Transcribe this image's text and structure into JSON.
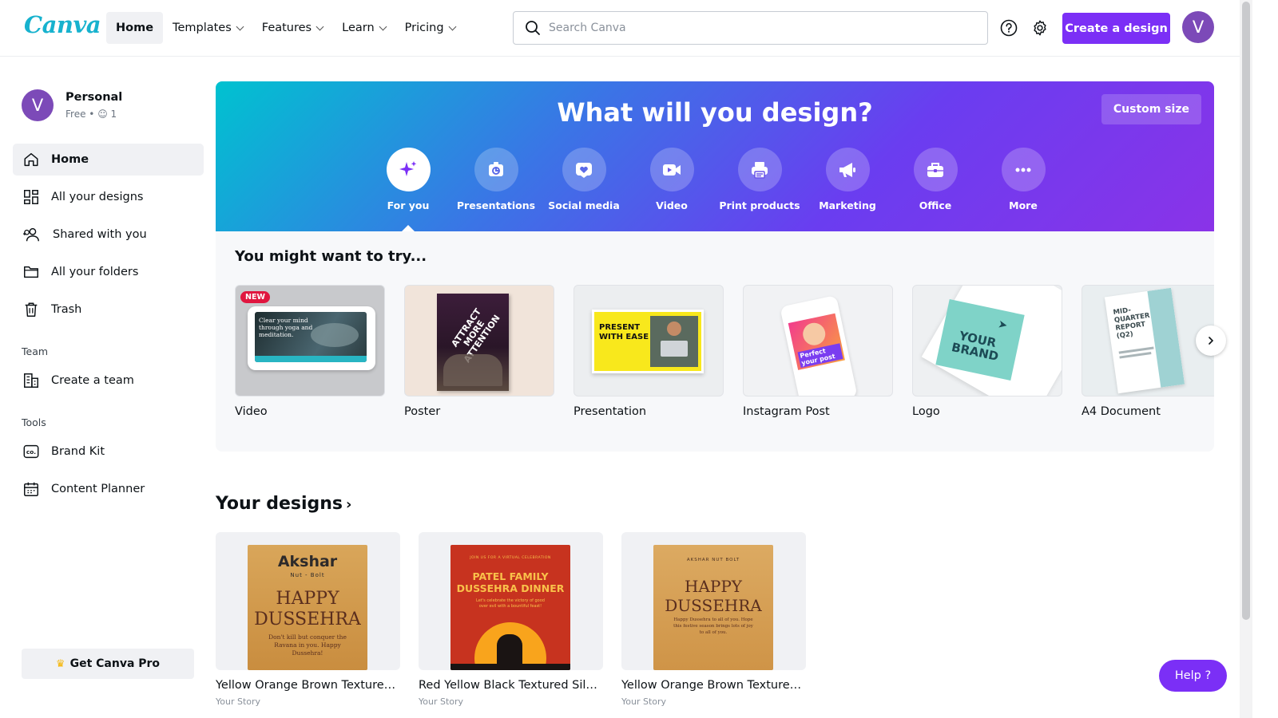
{
  "app": {
    "logo": "Canva"
  },
  "nav": {
    "home": "Home",
    "templates": "Templates",
    "features": "Features",
    "learn": "Learn",
    "pricing": "Pricing"
  },
  "search": {
    "placeholder": "Search Canva"
  },
  "header": {
    "create_label": "Create a design",
    "avatar_initial": "V"
  },
  "sidebar": {
    "profile": {
      "initial": "V",
      "name": "Personal",
      "plan": "Free",
      "members": "1"
    },
    "items": [
      {
        "label": "Home",
        "icon": "home-icon"
      },
      {
        "label": "All your designs",
        "icon": "grid-icon"
      },
      {
        "label": "Shared with you",
        "icon": "people-icon"
      },
      {
        "label": "All your folders",
        "icon": "folder-icon"
      },
      {
        "label": "Trash",
        "icon": "trash-icon"
      }
    ],
    "team_heading": "Team",
    "create_team": "Create a team",
    "tools_heading": "Tools",
    "brand_kit": "Brand Kit",
    "content_planner": "Content Planner",
    "get_pro": "Get Canva Pro"
  },
  "hero": {
    "title": "What will you design?",
    "custom_size": "Custom size",
    "categories": [
      {
        "label": "For you",
        "icon": "sparkle-icon"
      },
      {
        "label": "Presentations",
        "icon": "presentation-icon"
      },
      {
        "label": "Social media",
        "icon": "heart-icon"
      },
      {
        "label": "Video",
        "icon": "video-icon"
      },
      {
        "label": "Print products",
        "icon": "printer-icon"
      },
      {
        "label": "Marketing",
        "icon": "megaphone-icon"
      },
      {
        "label": "Office",
        "icon": "briefcase-icon"
      },
      {
        "label": "More",
        "icon": "more-icon"
      }
    ]
  },
  "try": {
    "heading": "You might want to try...",
    "new_badge": "NEW",
    "cards": [
      {
        "label": "Video",
        "thumb_text": "Clear your mind through yoga and meditation."
      },
      {
        "label": "Poster",
        "thumb_text": "ATTRACT MORE ATTENTION"
      },
      {
        "label": "Presentation",
        "thumb_text": "PRESENT WITH EASE"
      },
      {
        "label": "Instagram Post",
        "thumb_text": "Perfect your post"
      },
      {
        "label": "Logo",
        "thumb_text": "YOUR BRAND"
      },
      {
        "label": "A4 Document",
        "thumb_text": "MID-QUARTER REPORT (Q2)"
      }
    ]
  },
  "designs": {
    "heading": "Your designs",
    "items": [
      {
        "title": "Yellow Orange Brown Textured S...",
        "sub": "Your Story",
        "brand": "Akshar",
        "brand_sub": "Nut - Bolt",
        "line1": "HAPPY",
        "line2": "DUSSEHRA",
        "body": "Don't kill but conquer the Ravana in you. Happy Dussehra!"
      },
      {
        "title": "Red Yellow Black Textured Silho...",
        "sub": "Your Story",
        "top": "JOIN US FOR A VIRTUAL CELEBRATION",
        "line1": "PATEL FAMILY",
        "line2": "DUSSEHRA DINNER",
        "body": "Let's celebrate the victory of good over evil with a bountiful feast!"
      },
      {
        "title": "Yellow Orange Brown Textured S...",
        "sub": "Your Story",
        "brand": "AKSHAR NUT BOLT",
        "line1": "HAPPY",
        "line2": "DUSSEHRA",
        "body": "Happy Dussehra to all of you. Hope this festive season brings lots of joy to all of you."
      }
    ]
  },
  "help": {
    "label": "Help ?"
  },
  "colors": {
    "accent": "#7b2ff6",
    "logo": "#17b2ce"
  }
}
